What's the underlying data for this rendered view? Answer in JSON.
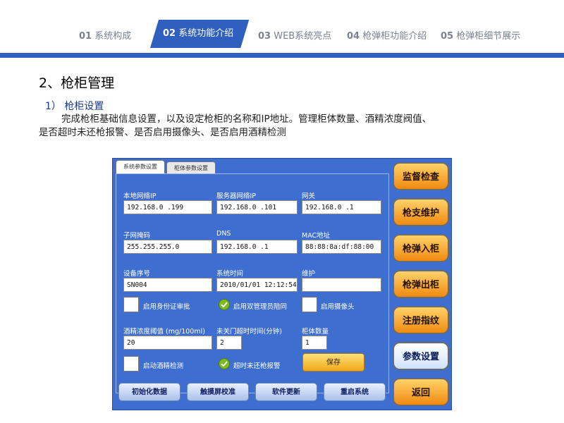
{
  "nav": {
    "tabs": [
      {
        "num": "01",
        "label": "系统构成"
      },
      {
        "num": "02",
        "label": "系统功能介绍"
      },
      {
        "num": "03",
        "label": "WEB系统亮点"
      },
      {
        "num": "04",
        "label": "枪弹柜功能介绍"
      },
      {
        "num": "05",
        "label": "枪弹柜细节展示"
      }
    ]
  },
  "section": {
    "title": "2、枪柜管理",
    "subtitle": "1）  枪柜设置",
    "desc_line1": "完成枪柜基础信息设置，以及设定枪柜的名称和IP地址。管理柜体数量、酒精浓度阀值、",
    "desc_line2": "是否超时未还枪报警、是否启用摄像头、是否启用酒精检测"
  },
  "app": {
    "tabs": [
      "系统参数设置",
      "柜体参数设置"
    ],
    "fields": {
      "local_ip": {
        "label": "本地网络IP",
        "value": "192.168.0  .199"
      },
      "server_ip": {
        "label": "服务器网络IP",
        "value": "192.168.0  .101"
      },
      "gateway": {
        "label": "网关",
        "value": "192.168.0  .1"
      },
      "subnet": {
        "label": "子网掩码",
        "value": "255.255.255.0"
      },
      "dns": {
        "label": "DNS",
        "value": "192.168.0  .1"
      },
      "mac": {
        "label": "MAC地址",
        "value": "88:88:8a:df:88:00"
      },
      "device_no": {
        "label": "设备序号",
        "value": "SN004"
      },
      "sys_time": {
        "label": "系统时间",
        "value": "2010/01/01 12:12:54"
      },
      "maintain": {
        "label": "维护",
        "value": ""
      },
      "alcohol_threshold": {
        "label": "酒精浓度阈值 (mg/100ml)",
        "value": "20"
      },
      "door_timeout": {
        "label": "未关门超时时间(分钟)",
        "value": "2"
      },
      "cabinet_count": {
        "label": "柜体数量",
        "value": "1"
      }
    },
    "checks": {
      "id_approval": {
        "label": "启用身份证审批",
        "checked": false
      },
      "dual_admin": {
        "label": "启用双管理员陪同",
        "checked": true
      },
      "camera": {
        "label": "启用摄像头",
        "checked": false
      },
      "alcohol_detect": {
        "label": "启动酒精检测",
        "checked": false
      },
      "overdue_alarm": {
        "label": "超时未还枪报警",
        "checked": true
      }
    },
    "save_label": "保存",
    "bottom_buttons": [
      "初始化数据",
      "触摸屏校准",
      "软件更新",
      "重启系统"
    ],
    "side_buttons": [
      "监督检查",
      "枪支维护",
      "枪弹入柜",
      "枪弹出柜",
      "注册指纹",
      "参数设置",
      "返回"
    ]
  },
  "colors": {
    "accent": "#2f5fbf",
    "panel": "#3e6fd0",
    "orange_button": "#f08a10",
    "check_green": "#7dbb1e"
  }
}
